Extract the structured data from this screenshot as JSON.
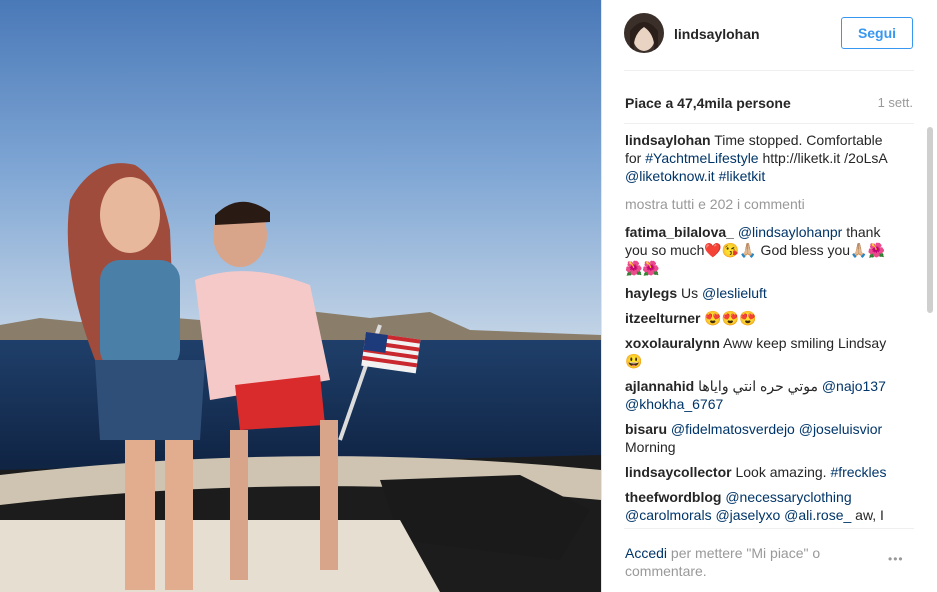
{
  "post": {
    "username": "lindsaylohan",
    "follow_label": "Segui",
    "likes": "Piace a 47,4mila persone",
    "time": "1 sett.",
    "caption_user": "lindsaylohan",
    "caption_text1": " Time stopped. Comfortable for ",
    "caption_tag1": "#YachtmeLifestyle",
    "caption_text2": " http://liketk.it /2oLsA ",
    "caption_tag2": "@liketoknow.it",
    "caption_text3": " ",
    "caption_tag3": "#liketkit",
    "show_all": "mostra tutti e 202 i commenti"
  },
  "comments": [
    {
      "user": "fatima_bilalova_",
      "link": "@lindsaylohanpr",
      "text": " thank you so much❤️😘🙏🏼 God bless you🙏🏼🌺🌺🌺",
      "link2": ""
    },
    {
      "user": "haylegs",
      "text": " Us ",
      "link": "@leslieluft",
      "link2": ""
    },
    {
      "user": "itzeelturner",
      "text": " 😍😍😍",
      "link": "",
      "link2": ""
    },
    {
      "user": "xoxolauralynn",
      "text": " Aww keep smiling Lindsay 😃",
      "link": "",
      "link2": ""
    },
    {
      "user": "ajlannahid",
      "text": " موتي حره انتي واياها ",
      "link": "@najo137",
      "link2": "@khokha_6767"
    },
    {
      "user": "bisaru",
      "text": " ",
      "link": "@fidelmatosverdejo",
      "link2": "@joseluisvior",
      "tail": " Morning"
    },
    {
      "user": "lindsaycollector",
      "text": " Look amazing. ",
      "link": "#freckles",
      "link2": ""
    },
    {
      "user": "theefwordblog",
      "text": " ",
      "link": "@necessaryclothing",
      "link2": "@carolmorals @jaselyxo @ali.rose_",
      "tail": " aw, I hope she's happy!"
    }
  ],
  "footer": {
    "login_link": "Accedi",
    "login_text": " per mettere \"Mi piace\" o commentare.",
    "more_icon": "•••"
  }
}
